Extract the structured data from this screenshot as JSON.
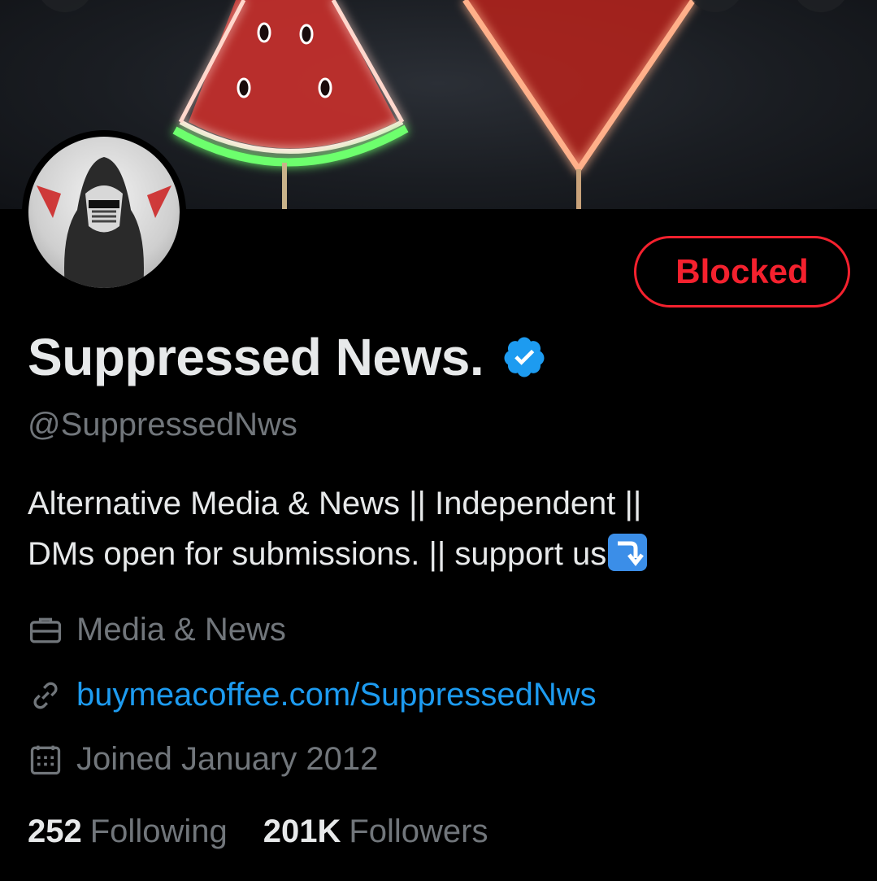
{
  "profile": {
    "display_name": "Suppressed News.",
    "handle": "@SuppressedNws",
    "verified_icon": "verified-badge-icon",
    "bio_line1": "Alternative Media & News || Independent ||",
    "bio_line2": "DMs open for submissions. || support us",
    "bio_emoji": "arrow-down-right-emoji",
    "category": "Media & News",
    "website": "buymeacoffee.com/SuppressedNws",
    "joined": "Joined January 2012",
    "following_count": "252",
    "following_label": "Following",
    "followers_count": "201K",
    "followers_label": "Followers"
  },
  "actions": {
    "blocked_label": "Blocked"
  },
  "colors": {
    "background": "#000000",
    "text_primary": "#e7e9ea",
    "text_secondary": "#71767b",
    "link": "#1d9bf0",
    "blocked": "#f4212e",
    "verified": "#1d9bf0"
  }
}
